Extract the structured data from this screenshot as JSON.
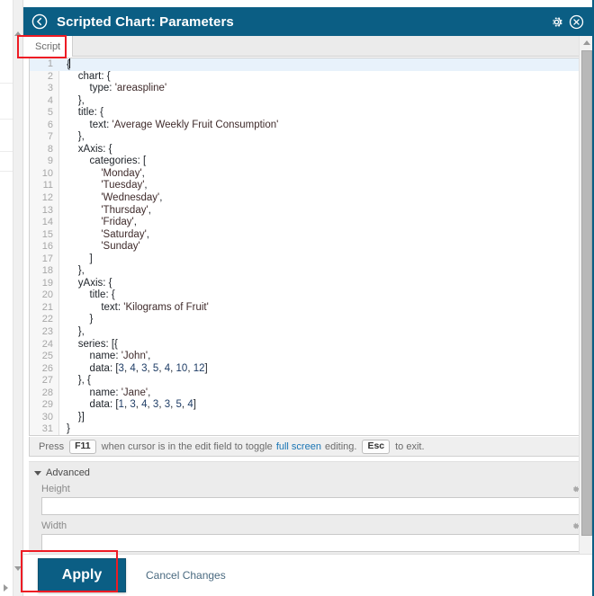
{
  "header": {
    "title": "Scripted Chart: Parameters",
    "back_icon": "circle-chevron-left-icon",
    "gear_icon": "gear-icon",
    "close_icon": "circle-close-icon",
    "bg_color": "#0b5e84"
  },
  "tabs": [
    {
      "label": "Script",
      "selected": true
    }
  ],
  "editor": {
    "cursor_line": 1,
    "lines": [
      {
        "n": "1",
        "text": "{"
      },
      {
        "n": "2",
        "text": "    chart: {"
      },
      {
        "n": "3",
        "text": "        type: 'areaspline'"
      },
      {
        "n": "4",
        "text": "    },"
      },
      {
        "n": "5",
        "text": "    title: {"
      },
      {
        "n": "6",
        "text": "        text: 'Average Weekly Fruit Consumption'"
      },
      {
        "n": "7",
        "text": "    },"
      },
      {
        "n": "8",
        "text": "    xAxis: {"
      },
      {
        "n": "9",
        "text": "        categories: ["
      },
      {
        "n": "10",
        "text": "            'Monday',"
      },
      {
        "n": "11",
        "text": "            'Tuesday',"
      },
      {
        "n": "12",
        "text": "            'Wednesday',"
      },
      {
        "n": "13",
        "text": "            'Thursday',"
      },
      {
        "n": "14",
        "text": "            'Friday',"
      },
      {
        "n": "15",
        "text": "            'Saturday',"
      },
      {
        "n": "16",
        "text": "            'Sunday'"
      },
      {
        "n": "17",
        "text": "        ]"
      },
      {
        "n": "18",
        "text": "    },"
      },
      {
        "n": "19",
        "text": "    yAxis: {"
      },
      {
        "n": "20",
        "text": "        title: {"
      },
      {
        "n": "21",
        "text": "            text: 'Kilograms of Fruit'"
      },
      {
        "n": "22",
        "text": "        }"
      },
      {
        "n": "23",
        "text": "    },"
      },
      {
        "n": "24",
        "text": "    series: [{"
      },
      {
        "n": "25",
        "text": "        name: 'John',"
      },
      {
        "n": "26",
        "text": "        data: [3, 4, 3, 5, 4, 10, 12]"
      },
      {
        "n": "27",
        "text": "    }, {"
      },
      {
        "n": "28",
        "text": "        name: 'Jane',"
      },
      {
        "n": "29",
        "text": "        data: [1, 3, 4, 3, 3, 5, 4]"
      },
      {
        "n": "30",
        "text": "    }]"
      },
      {
        "n": "31",
        "text": "}"
      }
    ]
  },
  "hint": {
    "part1": "Press",
    "key1": "F11",
    "part2": "when cursor is in the edit field to toggle",
    "link": "full screen",
    "part3": "editing.",
    "key2": "Esc",
    "part4": "to exit."
  },
  "advanced": {
    "section_label": "Advanced",
    "expanded": true,
    "fields": [
      {
        "label": "Height",
        "value": "",
        "placeholder": "",
        "gear_icon": "gear-icon"
      },
      {
        "label": "Width",
        "value": "",
        "placeholder": "",
        "gear_icon": "gear-icon"
      }
    ]
  },
  "footer": {
    "apply_label": "Apply",
    "cancel_label": "Cancel Changes",
    "apply_color": "#0b5e84"
  },
  "annotations": {
    "color": "#ee1b24",
    "boxes": [
      "script-tab",
      "apply-button"
    ]
  },
  "chart_data": {
    "type": "area",
    "title": "Average Weekly Fruit Consumption",
    "xlabel": "",
    "ylabel": "Kilograms of Fruit",
    "categories": [
      "Monday",
      "Tuesday",
      "Wednesday",
      "Thursday",
      "Friday",
      "Saturday",
      "Sunday"
    ],
    "series": [
      {
        "name": "John",
        "values": [
          3,
          4,
          3,
          5,
          4,
          10,
          12
        ]
      },
      {
        "name": "Jane",
        "values": [
          1,
          3,
          4,
          3,
          3,
          5,
          4
        ]
      }
    ],
    "chart_type_option": "areaspline",
    "legend": "default",
    "grid": true
  }
}
